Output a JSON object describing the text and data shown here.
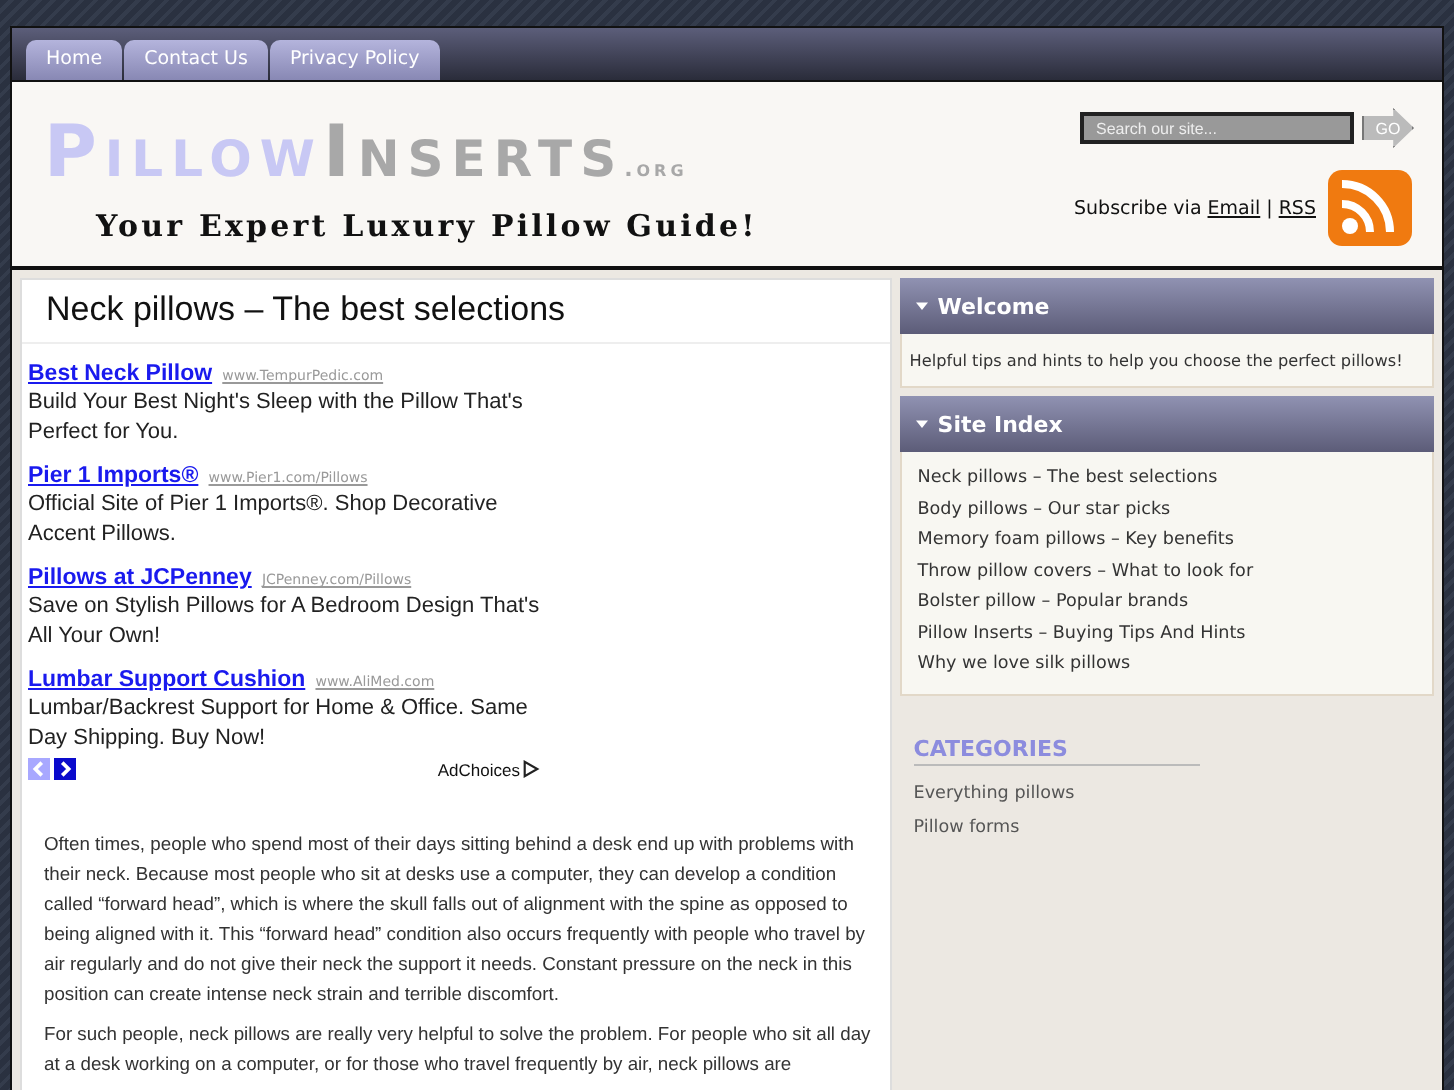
{
  "nav": {
    "tabs": [
      {
        "label": "Home"
      },
      {
        "label": "Contact Us"
      },
      {
        "label": "Privacy Policy"
      }
    ]
  },
  "header": {
    "logo": {
      "first": "Pillow",
      "second": "Inserts",
      "suffix": ".org"
    },
    "tagline": "Your Expert Luxury Pillow Guide!",
    "search": {
      "placeholder": "Search our site...",
      "button": "GO"
    },
    "subscribe": {
      "text": "Subscribe via",
      "email": "Email",
      "separator": "|",
      "rss": "RSS"
    }
  },
  "main": {
    "title": "Neck pillows – The best selections",
    "ads": [
      {
        "title": "Best Neck Pillow",
        "url": "www.TempurPedic.com",
        "text": "Build Your Best Night's Sleep with the Pillow That's Perfect for You."
      },
      {
        "title": "Pier 1 Imports®",
        "url": "www.Pier1.com/Pillows",
        "text": "Official Site of Pier 1 Imports®. Shop Decorative Accent Pillows."
      },
      {
        "title": "Pillows at JCPenney",
        "url": "JCPenney.com/Pillows",
        "text": "Save on Stylish Pillows for A Bedroom Design That's All Your Own!"
      },
      {
        "title": "Lumbar Support Cushion",
        "url": "www.AliMed.com",
        "text": "Lumbar/Backrest Support for Home & Office. Same Day Shipping. Buy Now!"
      }
    ],
    "ad_nav": {
      "prev_disabled": true,
      "next_disabled": false,
      "adchoices": "AdChoices"
    },
    "paragraphs": [
      "Often times, people who spend most of their days sitting behind a desk end up with problems with their neck.  Because most people who sit at desks use a computer, they can develop a condition called “forward head”, which is where the skull falls out of alignment with the spine as opposed to being aligned with it.  This “forward head” condition also occurs frequently with people who travel by air regularly and do not give their neck the support it needs.  Constant pressure on the neck in this position can create intense neck strain and terrible discomfort.",
      "For such people, neck pillows are really very helpful to solve the problem.  For people who sit all day at a desk working on a computer, or for those who travel frequently by air, neck pillows are"
    ]
  },
  "sidebar": {
    "welcome": {
      "title": "Welcome",
      "text": "Helpful tips and hints to help you choose the perfect pillows!"
    },
    "site_index": {
      "title": "Site Index",
      "links": [
        "Neck pillows – The best selections",
        "Body pillows – Our star picks",
        "Memory foam pillows – Key benefits",
        "Throw pillow covers – What to look for",
        "Bolster pillow – Popular brands",
        "Pillow Inserts – Buying Tips And Hints",
        "Why we love silk pillows"
      ]
    },
    "categories": {
      "title": "CATEGORIES",
      "links": [
        "Everything pillows",
        "Pillow forms"
      ]
    }
  }
}
